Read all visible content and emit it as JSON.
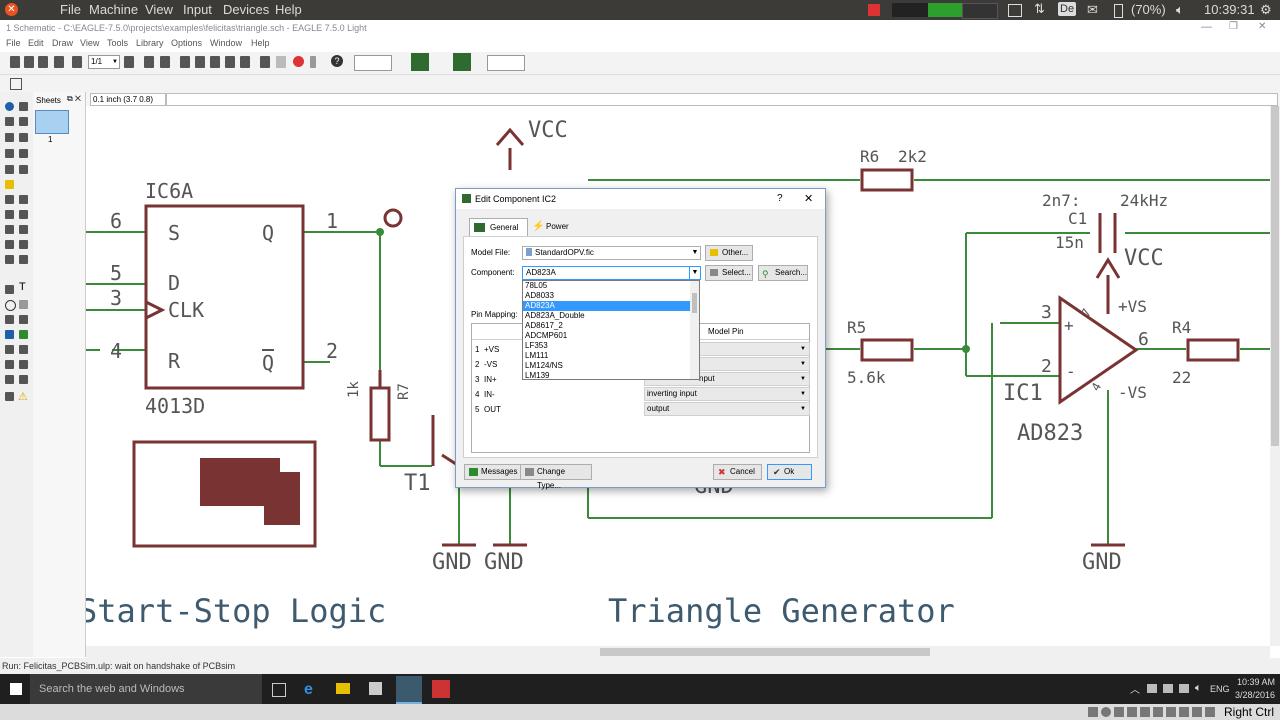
{
  "topbar": {
    "menus": [
      "File",
      "Machine",
      "View",
      "Input",
      "Devices",
      "Help"
    ],
    "keyboard": "De",
    "battery": "(70%)",
    "clock": "10:39:31"
  },
  "window": {
    "title": "1 Schematic - C:\\EAGLE-7.5.0\\projects\\examples\\felicitas\\triangle.sch - EAGLE 7.5.0 Light",
    "menus": [
      "File",
      "Edit",
      "Draw",
      "View",
      "Tools",
      "Library",
      "Options",
      "Window",
      "Help"
    ],
    "zoom_select": "1/1",
    "coord": "0.1 inch (3.7 0.8)",
    "sheets_label": "Sheets",
    "sheet_number": "1",
    "status": "Run: Felicitas_PCBSim.ulp: wait on handshake of PCBsim"
  },
  "schematic": {
    "section1": "Start-Stop Logic",
    "section2": "Triangle Generator",
    "ic6a": "IC6A",
    "ic6a_value": "4013D",
    "pin_s": "S",
    "pin_q": "Q",
    "pin_d": "D",
    "pin_clk": "CLK",
    "pin_r": "R",
    "pin_qbar": "Q",
    "pn6": "6",
    "pn5": "5",
    "pn3": "3",
    "pn4": "4",
    "pn1": "1",
    "pn2": "2",
    "vcc1": "VCC",
    "vcc2": "VCC",
    "r7": "R7",
    "r7_value": "1k",
    "t1": "T1",
    "gnd1": "GND",
    "gnd2": "GND",
    "gnd3": "GND",
    "gnd_hidden": "GND",
    "r6": "R6",
    "r6_value": "2k2",
    "c1_note": "2n7:",
    "c1_freq": "24kHz",
    "c1": "C1",
    "c1_value": "15n",
    "r5": "R5",
    "r5_value": "5.6k",
    "ic1": "IC1",
    "ic1_value": "AD823",
    "op_pin3": "3",
    "op_pin2": "2",
    "op_pin6": "6",
    "op_pin7": "7",
    "op_pin4": "4",
    "op_plus": "+",
    "op_minus": "-",
    "vs_pos": "+VS",
    "vs_neg": "-VS",
    "r4": "R4",
    "r4_value": "22"
  },
  "dialog": {
    "title": "Edit Component IC2",
    "help": "?",
    "tab_general": "General",
    "tab_power": "Power",
    "model_file_label": "Model File:",
    "model_file_value": "StandardOPV.fic",
    "other_button": "Other...",
    "component_label": "Component:",
    "component_value": "AD823A",
    "select_button": "Select...",
    "search_button": "Search...",
    "pin_mapping_label": "Pin Mapping:",
    "model_pin_header": "Model Pin",
    "dropdown_options": [
      "78L05",
      "AD8033",
      "AD823A",
      "AD823A_Double",
      "AD8617_2",
      "ADCMP601",
      "LF353",
      "LM111",
      "LM124/NS",
      "LM139"
    ],
    "selected_option": "AD823A",
    "pins": [
      {
        "num": "1",
        "name": "+VS",
        "model": ""
      },
      {
        "num": "2",
        "name": "-VS",
        "model": ""
      },
      {
        "num": "3",
        "name": "IN+",
        "model": "nput"
      },
      {
        "num": "4",
        "name": "IN-",
        "model": "inverting input"
      },
      {
        "num": "5",
        "name": "OUT",
        "model": "output"
      }
    ],
    "messages_button": "Messages",
    "change_type_button": "Change Type...",
    "cancel_button": "Cancel",
    "ok_button": "Ok"
  },
  "taskbar": {
    "search_placeholder": "Search the web and Windows",
    "lang": "ENG",
    "time": "10:39 AM",
    "date": "3/28/2016"
  },
  "bottom_tray": {
    "right_ctrl": "Right Ctrl"
  },
  "colors": {
    "wire": "#3b8a3b",
    "symbol": "#7a3333",
    "label_text": "#555555",
    "section_text": "#3e5a6e",
    "selection": "#3399ff"
  }
}
